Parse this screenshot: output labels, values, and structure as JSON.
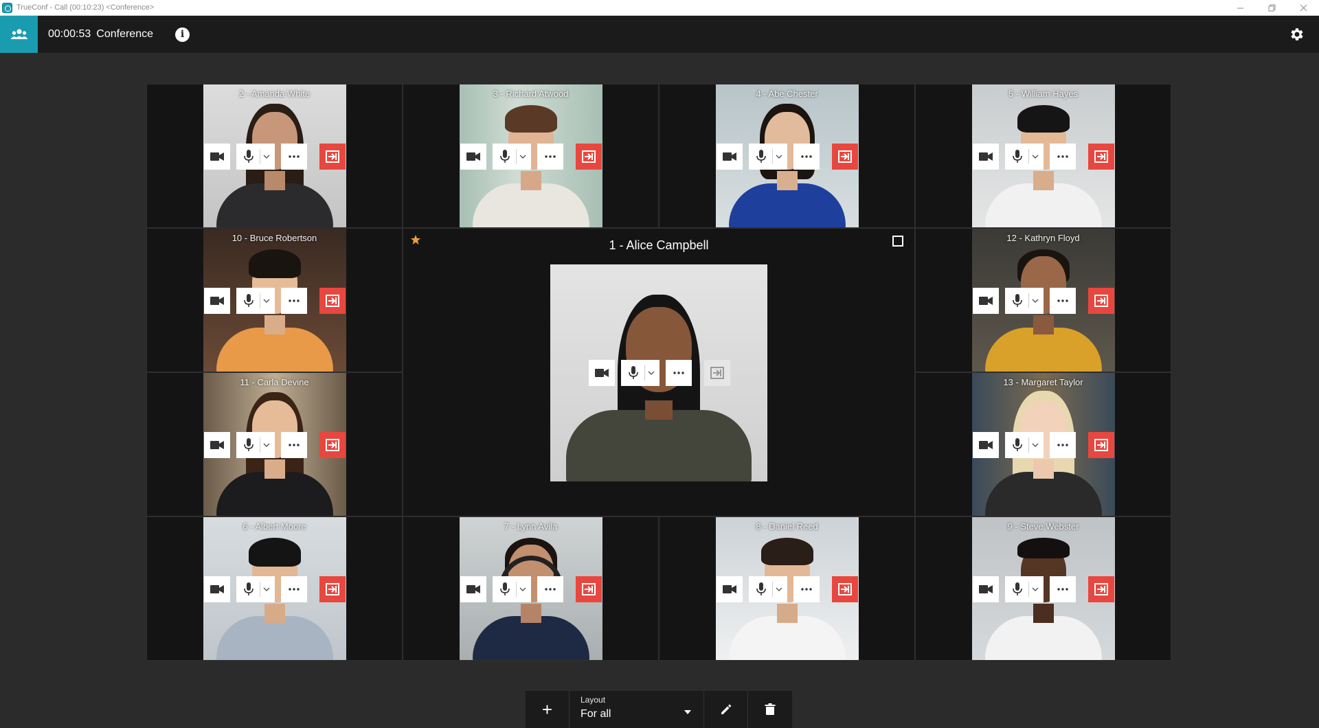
{
  "window": {
    "title": "TrueConf - Call (00:10:23) <Conference>"
  },
  "header": {
    "time": "00:00:53",
    "title": "Conference"
  },
  "main_participant": {
    "name": "1 - Alice Campbell"
  },
  "participants": [
    {
      "name": "2 - Amanda White"
    },
    {
      "name": "3 - Richard Atwood"
    },
    {
      "name": "4 - Abe Chester"
    },
    {
      "name": "5 - William Hayes"
    },
    {
      "name": "10 - Bruce Robertson"
    },
    {
      "name": "12 - Kathryn Floyd"
    },
    {
      "name": "11 - Carla Devine"
    },
    {
      "name": "13 - Margaret Taylor"
    },
    {
      "name": "6 - Albert Moore"
    },
    {
      "name": "7 - Lynn Avila"
    },
    {
      "name": "8 - Daniel Reed"
    },
    {
      "name": "9 - Steve Webster"
    }
  ],
  "toolbar": {
    "add_label": "+",
    "layout_label": "Layout",
    "layout_value": "For all"
  },
  "colors": {
    "accent": "#1a9cb0",
    "kick": "#e8473f",
    "header_bg": "#1b1b1b",
    "grid_bg": "#141414",
    "star": "#f0a030"
  },
  "icons": {
    "participants": "people-icon",
    "info": "info-icon",
    "settings": "gear-icon",
    "camera": "camera-icon",
    "mic": "microphone-icon",
    "more": "more-icon",
    "kick": "exit-icon",
    "star": "star-icon",
    "edit": "pencil-icon",
    "delete": "trash-icon"
  }
}
